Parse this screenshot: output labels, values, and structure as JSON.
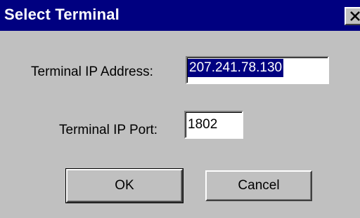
{
  "window": {
    "title": "Select Terminal",
    "close_icon": "close-x-icon"
  },
  "form": {
    "ip_label": "Terminal IP Address:",
    "ip_value": "207.241.78.130",
    "port_label": "Terminal IP Port:",
    "port_value": "1802"
  },
  "buttons": {
    "ok_label": "OK",
    "cancel_label": "Cancel"
  },
  "colors": {
    "titlebar": "#000080",
    "dialog_background": "#c0c0c0",
    "selection": "#000080"
  }
}
